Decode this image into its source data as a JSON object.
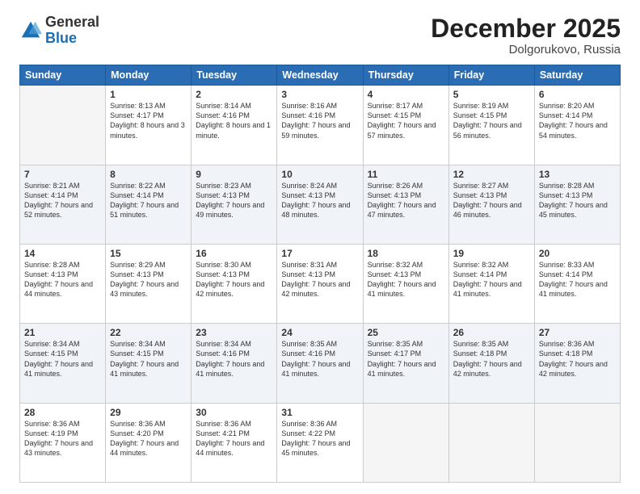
{
  "logo": {
    "general": "General",
    "blue": "Blue"
  },
  "title": "December 2025",
  "location": "Dolgorukovo, Russia",
  "days_header": [
    "Sunday",
    "Monday",
    "Tuesday",
    "Wednesday",
    "Thursday",
    "Friday",
    "Saturday"
  ],
  "weeks": [
    [
      {
        "day": "",
        "empty": true
      },
      {
        "day": "1",
        "sunrise": "Sunrise: 8:13 AM",
        "sunset": "Sunset: 4:17 PM",
        "daylight": "Daylight: 8 hours and 3 minutes."
      },
      {
        "day": "2",
        "sunrise": "Sunrise: 8:14 AM",
        "sunset": "Sunset: 4:16 PM",
        "daylight": "Daylight: 8 hours and 1 minute."
      },
      {
        "day": "3",
        "sunrise": "Sunrise: 8:16 AM",
        "sunset": "Sunset: 4:16 PM",
        "daylight": "Daylight: 7 hours and 59 minutes."
      },
      {
        "day": "4",
        "sunrise": "Sunrise: 8:17 AM",
        "sunset": "Sunset: 4:15 PM",
        "daylight": "Daylight: 7 hours and 57 minutes."
      },
      {
        "day": "5",
        "sunrise": "Sunrise: 8:19 AM",
        "sunset": "Sunset: 4:15 PM",
        "daylight": "Daylight: 7 hours and 56 minutes."
      },
      {
        "day": "6",
        "sunrise": "Sunrise: 8:20 AM",
        "sunset": "Sunset: 4:14 PM",
        "daylight": "Daylight: 7 hours and 54 minutes."
      }
    ],
    [
      {
        "day": "7",
        "sunrise": "Sunrise: 8:21 AM",
        "sunset": "Sunset: 4:14 PM",
        "daylight": "Daylight: 7 hours and 52 minutes."
      },
      {
        "day": "8",
        "sunrise": "Sunrise: 8:22 AM",
        "sunset": "Sunset: 4:14 PM",
        "daylight": "Daylight: 7 hours and 51 minutes."
      },
      {
        "day": "9",
        "sunrise": "Sunrise: 8:23 AM",
        "sunset": "Sunset: 4:13 PM",
        "daylight": "Daylight: 7 hours and 49 minutes."
      },
      {
        "day": "10",
        "sunrise": "Sunrise: 8:24 AM",
        "sunset": "Sunset: 4:13 PM",
        "daylight": "Daylight: 7 hours and 48 minutes."
      },
      {
        "day": "11",
        "sunrise": "Sunrise: 8:26 AM",
        "sunset": "Sunset: 4:13 PM",
        "daylight": "Daylight: 7 hours and 47 minutes."
      },
      {
        "day": "12",
        "sunrise": "Sunrise: 8:27 AM",
        "sunset": "Sunset: 4:13 PM",
        "daylight": "Daylight: 7 hours and 46 minutes."
      },
      {
        "day": "13",
        "sunrise": "Sunrise: 8:28 AM",
        "sunset": "Sunset: 4:13 PM",
        "daylight": "Daylight: 7 hours and 45 minutes."
      }
    ],
    [
      {
        "day": "14",
        "sunrise": "Sunrise: 8:28 AM",
        "sunset": "Sunset: 4:13 PM",
        "daylight": "Daylight: 7 hours and 44 minutes."
      },
      {
        "day": "15",
        "sunrise": "Sunrise: 8:29 AM",
        "sunset": "Sunset: 4:13 PM",
        "daylight": "Daylight: 7 hours and 43 minutes."
      },
      {
        "day": "16",
        "sunrise": "Sunrise: 8:30 AM",
        "sunset": "Sunset: 4:13 PM",
        "daylight": "Daylight: 7 hours and 42 minutes."
      },
      {
        "day": "17",
        "sunrise": "Sunrise: 8:31 AM",
        "sunset": "Sunset: 4:13 PM",
        "daylight": "Daylight: 7 hours and 42 minutes."
      },
      {
        "day": "18",
        "sunrise": "Sunrise: 8:32 AM",
        "sunset": "Sunset: 4:13 PM",
        "daylight": "Daylight: 7 hours and 41 minutes."
      },
      {
        "day": "19",
        "sunrise": "Sunrise: 8:32 AM",
        "sunset": "Sunset: 4:14 PM",
        "daylight": "Daylight: 7 hours and 41 minutes."
      },
      {
        "day": "20",
        "sunrise": "Sunrise: 8:33 AM",
        "sunset": "Sunset: 4:14 PM",
        "daylight": "Daylight: 7 hours and 41 minutes."
      }
    ],
    [
      {
        "day": "21",
        "sunrise": "Sunrise: 8:34 AM",
        "sunset": "Sunset: 4:15 PM",
        "daylight": "Daylight: 7 hours and 41 minutes."
      },
      {
        "day": "22",
        "sunrise": "Sunrise: 8:34 AM",
        "sunset": "Sunset: 4:15 PM",
        "daylight": "Daylight: 7 hours and 41 minutes."
      },
      {
        "day": "23",
        "sunrise": "Sunrise: 8:34 AM",
        "sunset": "Sunset: 4:16 PM",
        "daylight": "Daylight: 7 hours and 41 minutes."
      },
      {
        "day": "24",
        "sunrise": "Sunrise: 8:35 AM",
        "sunset": "Sunset: 4:16 PM",
        "daylight": "Daylight: 7 hours and 41 minutes."
      },
      {
        "day": "25",
        "sunrise": "Sunrise: 8:35 AM",
        "sunset": "Sunset: 4:17 PM",
        "daylight": "Daylight: 7 hours and 41 minutes."
      },
      {
        "day": "26",
        "sunrise": "Sunrise: 8:35 AM",
        "sunset": "Sunset: 4:18 PM",
        "daylight": "Daylight: 7 hours and 42 minutes."
      },
      {
        "day": "27",
        "sunrise": "Sunrise: 8:36 AM",
        "sunset": "Sunset: 4:18 PM",
        "daylight": "Daylight: 7 hours and 42 minutes."
      }
    ],
    [
      {
        "day": "28",
        "sunrise": "Sunrise: 8:36 AM",
        "sunset": "Sunset: 4:19 PM",
        "daylight": "Daylight: 7 hours and 43 minutes."
      },
      {
        "day": "29",
        "sunrise": "Sunrise: 8:36 AM",
        "sunset": "Sunset: 4:20 PM",
        "daylight": "Daylight: 7 hours and 44 minutes."
      },
      {
        "day": "30",
        "sunrise": "Sunrise: 8:36 AM",
        "sunset": "Sunset: 4:21 PM",
        "daylight": "Daylight: 7 hours and 44 minutes."
      },
      {
        "day": "31",
        "sunrise": "Sunrise: 8:36 AM",
        "sunset": "Sunset: 4:22 PM",
        "daylight": "Daylight: 7 hours and 45 minutes."
      },
      {
        "day": "",
        "empty": true
      },
      {
        "day": "",
        "empty": true
      },
      {
        "day": "",
        "empty": true
      }
    ]
  ]
}
